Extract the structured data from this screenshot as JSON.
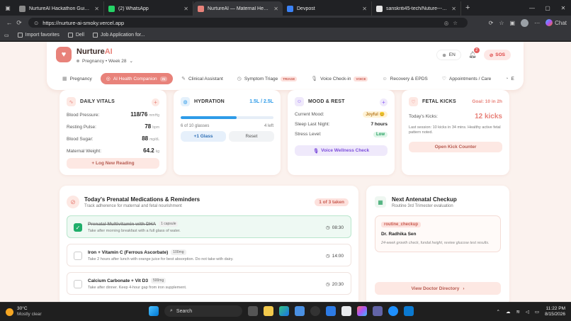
{
  "browser": {
    "tabs": [
      {
        "title": "NurtureAI Hackathon Guidance",
        "color": "#8a8a8a",
        "active": false
      },
      {
        "title": "(2) WhatsApp",
        "color": "#25d366",
        "active": false
      },
      {
        "title": "NurtureAI — Maternal Health, Fet...",
        "color": "#e8827a",
        "active": true
      },
      {
        "title": "Devpost",
        "color": "#3b82f6",
        "active": false
      },
      {
        "title": "sanskriti45-tech/Nuture---AI: Nurtur...",
        "color": "#e6e6e6",
        "active": false
      }
    ],
    "url": "https://nurture-ai-smoky.vercel.app",
    "chat_label": "Chat",
    "bookmarks": [
      "Import favorites",
      "Dell",
      "Job Application for..."
    ]
  },
  "header": {
    "brand_main": "Nurture",
    "brand_accent": "AI",
    "subtitle": "Pregnancy • Week 28",
    "lang": "EN",
    "notif_count": "2",
    "sos": "SOS"
  },
  "nav": [
    {
      "label": "Pregnancy",
      "tag": "",
      "icon": "▦",
      "active": false
    },
    {
      "label": "AI Health Companion",
      "tag": "AI",
      "icon": "◎",
      "active": true
    },
    {
      "label": "Clinical Assistant",
      "tag": "",
      "icon": "✎",
      "active": false
    },
    {
      "label": "Symptom Triage",
      "tag": "TRIAGE",
      "icon": "◷",
      "active": false
    },
    {
      "label": "Voice Check-in",
      "tag": "VOICE",
      "icon": "🎙",
      "active": false
    },
    {
      "label": "Recovery & EPDS",
      "tag": "",
      "icon": "☺",
      "active": false
    },
    {
      "label": "Appointments / Care",
      "tag": "",
      "icon": "♡",
      "active": false
    },
    {
      "label": "E",
      "tag": "",
      "icon": "◔",
      "active": false
    }
  ],
  "vitals": {
    "title": "DAILY VITALS",
    "rows": [
      {
        "label": "Blood Pressure:",
        "value": "118/76",
        "unit": "mmHg"
      },
      {
        "label": "Resting Pulse:",
        "value": "78",
        "unit": "bpm"
      },
      {
        "label": "Blood Sugar:",
        "value": "88",
        "unit": "mg/dL"
      },
      {
        "label": "Maternal Weight:",
        "value": "64.2",
        "unit": "kg"
      }
    ],
    "button": "+ Log New Reading"
  },
  "hydration": {
    "title": "HYDRATION",
    "amount": "1.5L / 2.5L",
    "progress": 0.6,
    "glasses": "6 of 10 glasses",
    "left": "4 left",
    "add_button": "+1 Glass",
    "reset_button": "Reset"
  },
  "mood": {
    "title": "MOOD & REST",
    "rows": [
      {
        "label": "Current Mood:",
        "value": "Joyful 😊"
      },
      {
        "label": "Sleep Last Night:",
        "value": "7 hours"
      },
      {
        "label": "Stress Level:",
        "value": "Low"
      }
    ],
    "button": "Voice Wellness Check"
  },
  "fetal": {
    "title": "FETAL KICKS",
    "goal": "Goal: 10 in 2h",
    "kicks_label": "Today's Kicks:",
    "kicks_value": "12 kicks",
    "note": "Last session: 10 kicks in 34 mins. Healthy active fetal pattern noted.",
    "button": "Open Kick Counter"
  },
  "meds": {
    "title": "Today's Prenatal Medications & Reminders",
    "subtitle": "Track adherence for maternal and fetal nourishment",
    "badge": "1 of 3 taken",
    "items": [
      {
        "name": "Prenatal Multivitamin with DHA",
        "dose": "1 capsule",
        "note": "Take after morning breakfast with a full glass of water.",
        "time": "08:30",
        "done": true
      },
      {
        "name": "Iron + Vitamin C (Ferrous Ascorbate)",
        "dose": "100mg",
        "note": "Take 2 hours after lunch with orange juice for best absorption. Do not take with dairy.",
        "time": "14:00",
        "done": false
      },
      {
        "name": "Calcium Carbonate + Vit D3",
        "dose": "500mg",
        "note": "Take after dinner. Keep 4-hour gap from iron supplement.",
        "time": "20:30",
        "done": false
      }
    ]
  },
  "checkup": {
    "title": "Next Antenatal Checkup",
    "subtitle": "Routine 3rd Trimester evaluation",
    "tag": "routine_checkup",
    "doctor": "Dr. Radhika Sen",
    "detail": "24-week growth check, fundal height, review glucose test results.",
    "button": "View Doctor Directory"
  },
  "taskbar": {
    "temp": "30°C",
    "weather": "Mostly clear",
    "search": "Search",
    "time": "11:22 PM",
    "date": "8/15/2026"
  },
  "colors": {
    "accent": "#e8827a",
    "blue": "#2e9be8",
    "green": "#1fae6a"
  }
}
